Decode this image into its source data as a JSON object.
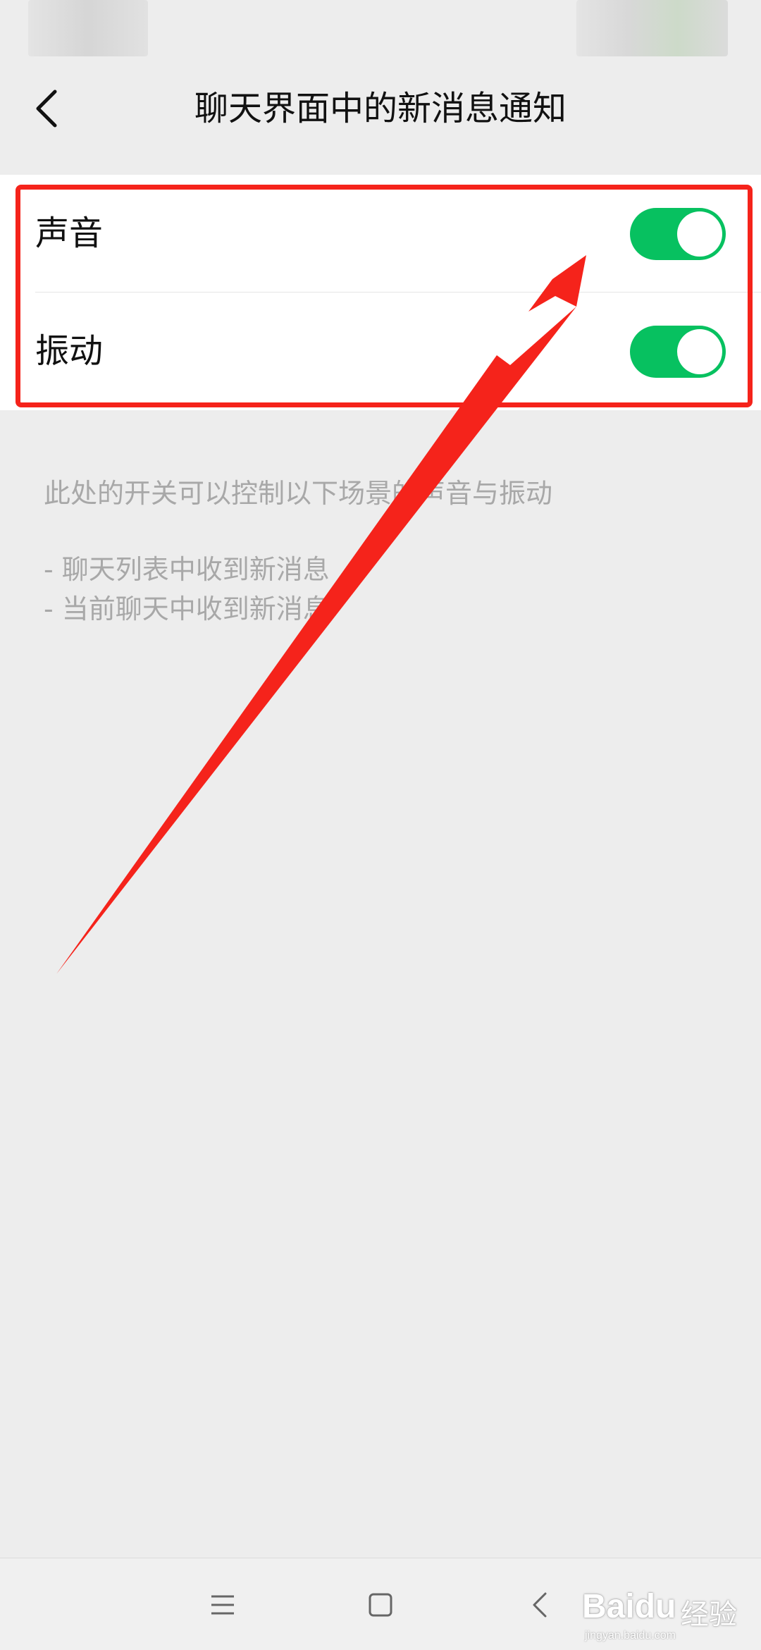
{
  "header": {
    "title": "聊天界面中的新消息通知"
  },
  "settings": {
    "sound_label": "声音",
    "vibrate_label": "振动",
    "sound_on": true,
    "vibrate_on": true
  },
  "description": {
    "main": "此处的开关可以控制以下场景的声音与振动",
    "items": [
      "- 聊天列表中收到新消息",
      "- 当前聊天中收到新消息"
    ]
  },
  "watermark": {
    "logo": "Baidu",
    "label": "经验",
    "url": "jingyan.baidu.com"
  },
  "colors": {
    "accent_green": "#07c160",
    "annotation_red": "#f5231b",
    "background": "#ededed"
  },
  "icons": {
    "back": "chevron-left-icon",
    "menu": "menu-icon",
    "home": "square-home-icon",
    "sys_back": "chevron-left-icon"
  }
}
